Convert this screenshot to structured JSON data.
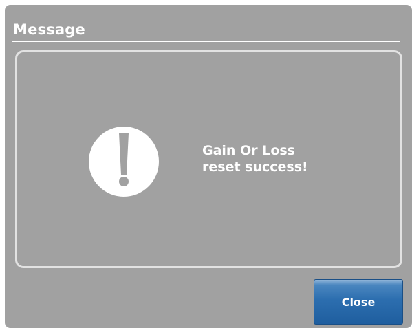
{
  "dialog": {
    "title": "Message",
    "message_line1": "Gain Or Loss",
    "message_line2": "reset success!",
    "icon": "exclamation-icon",
    "close_label": "Close"
  },
  "colors": {
    "dialog_background": "#a1a1a1",
    "text": "#ffffff",
    "panel_border": "#e2e2e2",
    "button_blue": "#2c6eaf"
  }
}
